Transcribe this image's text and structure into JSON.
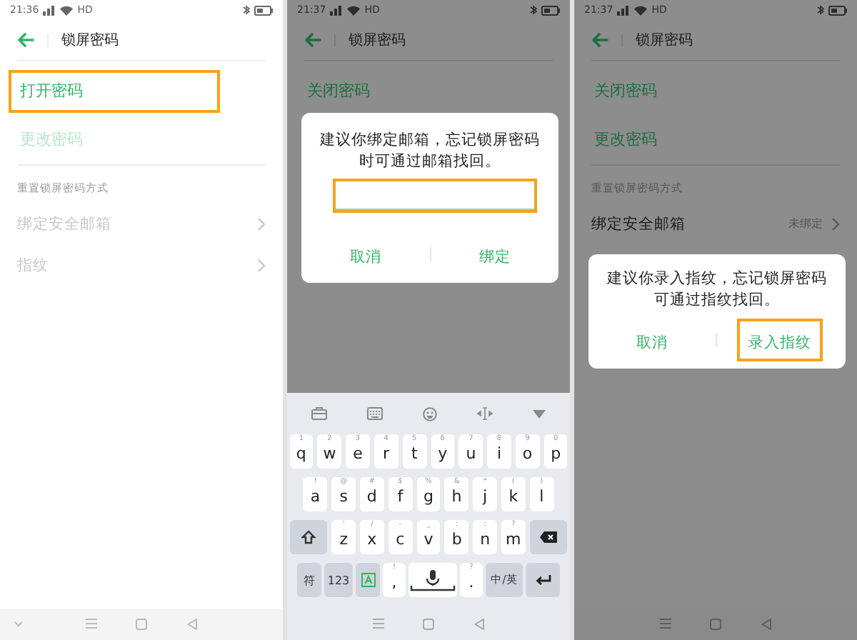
{
  "screens": [
    {
      "status_bar": {
        "time": "21:36",
        "network": "HD"
      },
      "header": {
        "title": "锁屏密码"
      },
      "dimmed": false,
      "items": [
        {
          "kind": "action",
          "label": "打开密码",
          "disabled": false,
          "highlighted": true
        },
        {
          "kind": "action",
          "label": "更改密码",
          "disabled": true,
          "highlighted": false
        },
        {
          "kind": "section",
          "label": "重置锁屏密码方式"
        },
        {
          "kind": "link",
          "label": "绑定安全邮箱",
          "disabled": true
        },
        {
          "kind": "link",
          "label": "指纹",
          "disabled": true
        }
      ],
      "nav_bar": {
        "collapse_button": true
      }
    },
    {
      "status_bar": {
        "time": "21:37",
        "network": "HD"
      },
      "header": {
        "title": "锁屏密码"
      },
      "dimmed": true,
      "items": [
        {
          "kind": "action",
          "label": "关闭密码",
          "disabled": false,
          "highlighted": false
        }
      ],
      "dialog": {
        "message": "建议你绑定邮箱，忘记锁屏密码时可通过邮箱找回。",
        "input": {
          "highlighted": true
        },
        "buttons": [
          {
            "label": "取消",
            "highlighted": false
          },
          {
            "label": "绑定",
            "highlighted": false
          }
        ]
      },
      "keyboard": {
        "rows": [
          {
            "keys": [
              {
                "kind": "char",
                "label": "q",
                "hint": "1"
              },
              {
                "kind": "char",
                "label": "w",
                "hint": "2"
              },
              {
                "kind": "char",
                "label": "e",
                "hint": "3"
              },
              {
                "kind": "char",
                "label": "r",
                "hint": "4"
              },
              {
                "kind": "char",
                "label": "t",
                "hint": "5"
              },
              {
                "kind": "char",
                "label": "y",
                "hint": "6"
              },
              {
                "kind": "char",
                "label": "u",
                "hint": "7"
              },
              {
                "kind": "char",
                "label": "i",
                "hint": "8"
              },
              {
                "kind": "char",
                "label": "o",
                "hint": "9"
              },
              {
                "kind": "char",
                "label": "p",
                "hint": "0"
              }
            ]
          },
          {
            "keys": [
              {
                "kind": "char",
                "label": "a",
                "hint": "!"
              },
              {
                "kind": "char",
                "label": "s",
                "hint": "@"
              },
              {
                "kind": "char",
                "label": "d",
                "hint": "#"
              },
              {
                "kind": "char",
                "label": "f",
                "hint": "$"
              },
              {
                "kind": "char",
                "label": "g",
                "hint": "%"
              },
              {
                "kind": "char",
                "label": "h",
                "hint": "&"
              },
              {
                "kind": "char",
                "label": "j",
                "hint": "*"
              },
              {
                "kind": "char",
                "label": "k",
                "hint": "("
              },
              {
                "kind": "char",
                "label": "l",
                "hint": ")"
              }
            ]
          },
          {
            "keys": [
              {
                "kind": "shift"
              },
              {
                "kind": "char",
                "label": "z",
                "hint": "'"
              },
              {
                "kind": "char",
                "label": "x",
                "hint": "/"
              },
              {
                "kind": "char",
                "label": "c",
                "hint": "-"
              },
              {
                "kind": "char",
                "label": "v",
                "hint": "_"
              },
              {
                "kind": "char",
                "label": "b",
                "hint": ":"
              },
              {
                "kind": "char",
                "label": "n",
                "hint": ";"
              },
              {
                "kind": "char",
                "label": "m",
                "hint": "?"
              },
              {
                "kind": "delete"
              }
            ]
          },
          {
            "keys": [
              {
                "kind": "func",
                "label": "符"
              },
              {
                "kind": "func",
                "label": "123"
              },
              {
                "kind": "layout"
              },
              {
                "kind": "char",
                "label": ",",
                "hint": "!"
              },
              {
                "kind": "space"
              },
              {
                "kind": "char",
                "label": ".",
                "hint": "?"
              },
              {
                "kind": "func",
                "label": "中/英"
              },
              {
                "kind": "enter"
              }
            ]
          }
        ]
      },
      "nav_bar": {
        "collapse_button": false
      }
    },
    {
      "status_bar": {
        "time": "21:37",
        "network": "HD"
      },
      "header": {
        "title": "锁屏密码"
      },
      "dimmed": true,
      "items": [
        {
          "kind": "action",
          "label": "关闭密码",
          "disabled": false,
          "highlighted": false
        },
        {
          "kind": "action",
          "label": "更改密码",
          "disabled": false,
          "highlighted": false
        },
        {
          "kind": "section",
          "label": "重置锁屏密码方式"
        },
        {
          "kind": "link",
          "label": "绑定安全邮箱",
          "value": "未绑定",
          "disabled": false
        }
      ],
      "dialog": {
        "message": "建议你录入指纹，忘记锁屏密码可通过指纹找回。",
        "buttons": [
          {
            "label": "取消",
            "highlighted": false
          },
          {
            "label": "录入指纹",
            "highlighted": true
          }
        ]
      },
      "nav_bar": {
        "collapse_button": false
      }
    }
  ]
}
